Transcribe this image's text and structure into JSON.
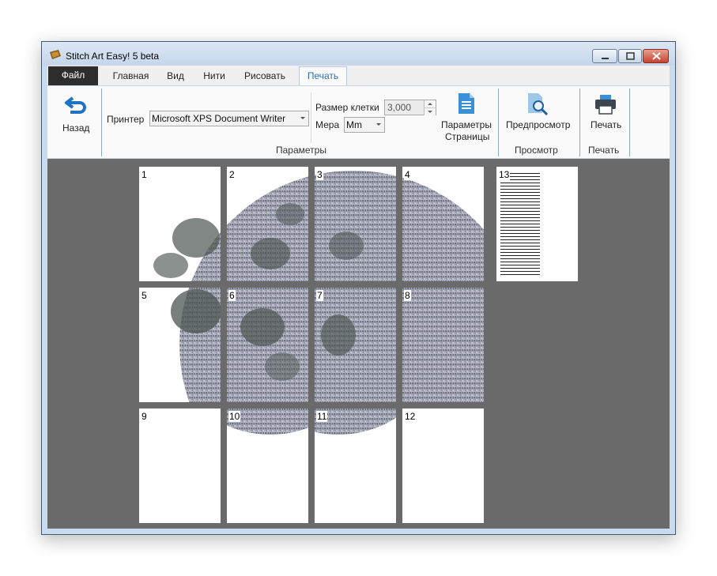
{
  "window": {
    "title": "Stitch Art Easy! 5 beta"
  },
  "tabs": [
    {
      "label": "Файл"
    },
    {
      "label": "Главная"
    },
    {
      "label": "Вид"
    },
    {
      "label": "Нити"
    },
    {
      "label": "Рисовать"
    },
    {
      "label": "Печать"
    }
  ],
  "active_tab": "Печать",
  "ribbon": {
    "back_label": "Назад",
    "printer_label": "Принтер",
    "printer_value": "Microsoft XPS Document Writer",
    "cell_size_label": "Размер клетки",
    "cell_size_value": "3,000",
    "unit_label": "Мера",
    "unit_value": "Mm",
    "page_params_line1": "Параметры",
    "page_params_line2": "Страницы",
    "group_params": "Параметры",
    "preview_label": "Предпросмотр",
    "group_preview": "Просмотр",
    "print_label": "Печать",
    "group_print": "Печать"
  },
  "pages": [
    "1",
    "2",
    "3",
    "4",
    "5",
    "6",
    "7",
    "8",
    "9",
    "10",
    "11",
    "12",
    "13"
  ],
  "colors": {
    "accent_blue": "#2a6fb6",
    "file_tab_bg": "#2d2d2d",
    "preview_bg": "#6a6a6a",
    "close_button": "#c6432f"
  },
  "icons": [
    "app-icon",
    "back-arrow-icon",
    "page-settings-icon",
    "preview-magnifier-icon",
    "printer-icon",
    "minimize-icon",
    "maximize-icon",
    "close-icon"
  ]
}
